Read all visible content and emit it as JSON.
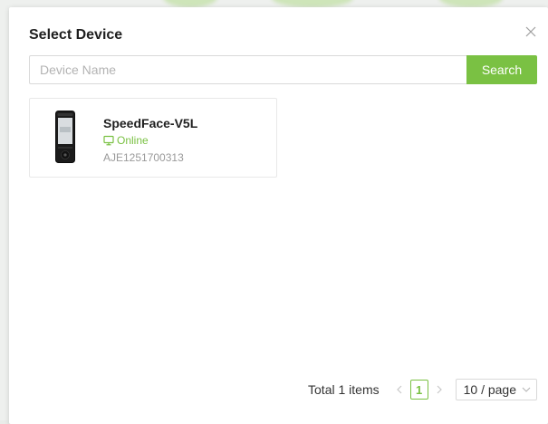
{
  "modal": {
    "title": "Select Device",
    "close_icon": "close-icon"
  },
  "search": {
    "placeholder": "Device Name",
    "value": "",
    "button_label": "Search"
  },
  "devices": [
    {
      "name": "SpeedFace-V5L",
      "status": "Online",
      "status_icon": "monitor-icon",
      "serial": "AJE1251700313"
    }
  ],
  "pagination": {
    "total_label": "Total 1 items",
    "prev_icon": "chevron-left-icon",
    "current_page": "1",
    "next_icon": "chevron-right-icon",
    "page_size_label": "10 / page",
    "page_size_icon": "chevron-down-icon"
  },
  "colors": {
    "accent": "#7ac143",
    "border": "#d9d9d9",
    "muted_text": "#9a9a9a"
  }
}
